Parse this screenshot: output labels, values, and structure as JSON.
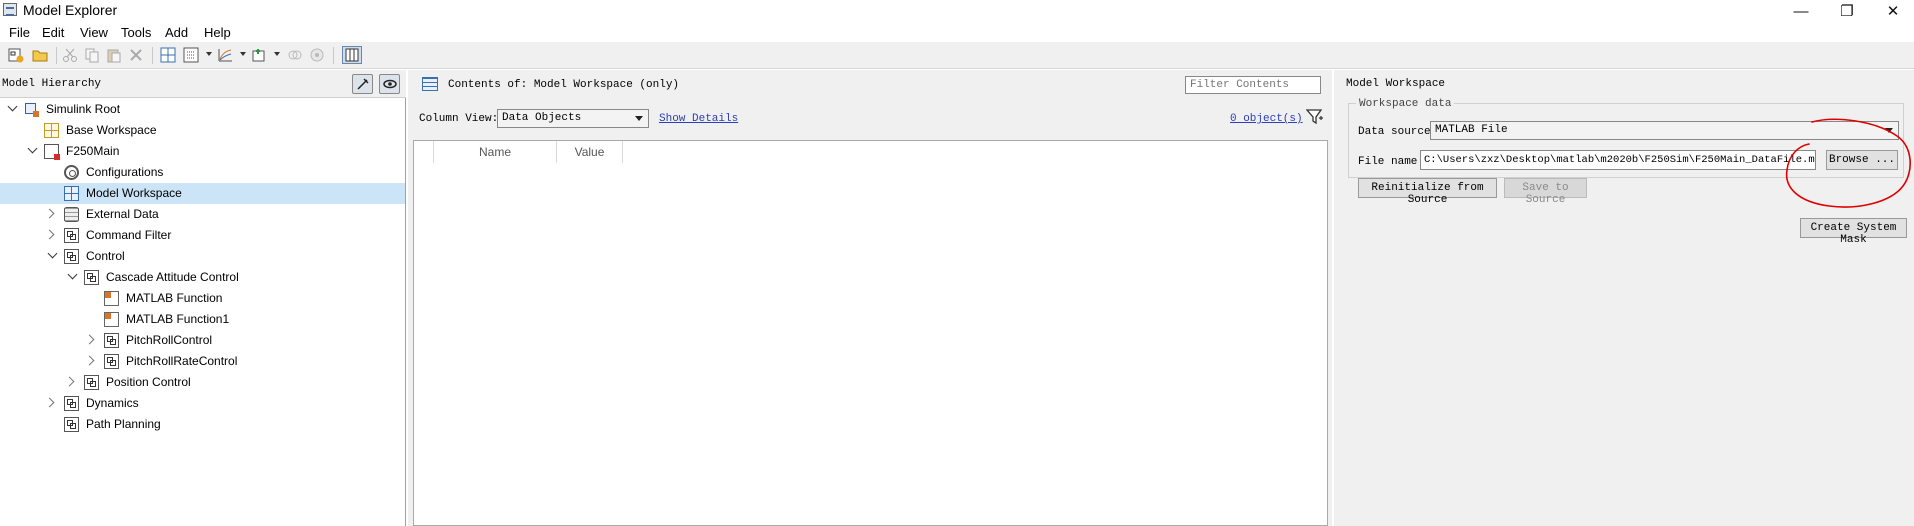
{
  "window": {
    "title": "Model Explorer",
    "controls": {
      "minimize": "—",
      "restore": "❐",
      "close": "✕"
    }
  },
  "menu": [
    "File",
    "Edit",
    "View",
    "Tools",
    "Add",
    "Help"
  ],
  "toolbar": {
    "icons": [
      "new-model-icon",
      "open-icon",
      "cut-icon",
      "copy-icon",
      "paste-icon",
      "delete-icon",
      "add-block-icon",
      "add-table-icon",
      "add-chart-icon",
      "add-stateflow-icon",
      "link-icon",
      "fixed-point-icon",
      "show-dialog-icon"
    ]
  },
  "left_pane": {
    "title": "Model Hierarchy",
    "tree": [
      {
        "label": "Simulink Root",
        "level": 0,
        "expander": "down",
        "icon": "simulink-root-icon"
      },
      {
        "label": "Base Workspace",
        "level": 1,
        "expander": "none",
        "icon": "base-workspace-icon"
      },
      {
        "label": "F250Main",
        "level": 1,
        "expander": "down",
        "icon": "model-icon"
      },
      {
        "label": "Configurations",
        "level": 2,
        "expander": "none",
        "icon": "gear-icon"
      },
      {
        "label": "Model Workspace",
        "level": 2,
        "expander": "none",
        "icon": "model-workspace-icon",
        "selected": true
      },
      {
        "label": "External Data",
        "level": 2,
        "expander": "right",
        "icon": "database-icon"
      },
      {
        "label": "Command Filter",
        "level": 2,
        "expander": "right",
        "icon": "subsystem-icon"
      },
      {
        "label": "Control",
        "level": 2,
        "expander": "down",
        "icon": "subsystem-icon"
      },
      {
        "label": "Cascade Attitude Control",
        "level": 3,
        "expander": "down",
        "icon": "subsystem-icon"
      },
      {
        "label": "MATLAB Function",
        "level": 4,
        "expander": "none",
        "icon": "matlab-function-icon"
      },
      {
        "label": "MATLAB Function1",
        "level": 4,
        "expander": "none",
        "icon": "matlab-function-icon"
      },
      {
        "label": "PitchRollControl",
        "level": 4,
        "expander": "right",
        "icon": "subsystem-icon"
      },
      {
        "label": "PitchRollRateControl",
        "level": 4,
        "expander": "right",
        "icon": "subsystem-icon"
      },
      {
        "label": "Position Control",
        "level": 3,
        "expander": "right",
        "icon": "subsystem-icon"
      },
      {
        "label": "Dynamics",
        "level": 2,
        "expander": "right",
        "icon": "subsystem-icon"
      },
      {
        "label": "Path Planning",
        "level": 2,
        "expander": "none",
        "icon": "subsystem-icon"
      }
    ]
  },
  "middle_pane": {
    "contents_label": "Contents of: Model Workspace (only)",
    "filter_placeholder": "Filter Contents",
    "column_view_label": "Column View:",
    "column_view_value": "Data Objects",
    "show_details": "Show Details",
    "object_count": "0 object(s)",
    "columns": [
      "Name",
      "Value"
    ]
  },
  "right_pane": {
    "title": "Model Workspace",
    "group_label": "Workspace data",
    "data_source_label": "Data source:",
    "data_source_value": "MATLAB File",
    "file_name_label": "File name:",
    "file_name_value": "C:\\Users\\zxz\\Desktop\\matlab\\m2020b\\F250Sim\\F250Main_DataFile.m",
    "browse_label": "Browse ...",
    "reinit_label": "Reinitialize from Source",
    "save_label": "Save to Source",
    "mask_label": "Create System Mask",
    "annotation_color": "#e00000"
  }
}
